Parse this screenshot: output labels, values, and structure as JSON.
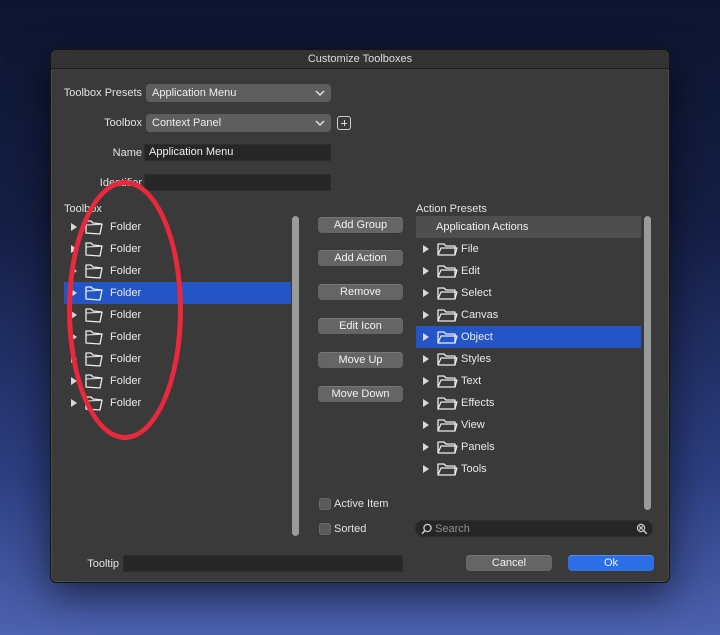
{
  "dialog": {
    "title": "Customize Toolboxes"
  },
  "form": {
    "presets_label": "Toolbox Presets",
    "presets_value": "Application Menu",
    "toolbox_label": "Toolbox",
    "toolbox_value": "Context Panel",
    "name_label": "Name",
    "name_value": "Application Menu",
    "identifier_label": "Identifier",
    "identifier_value": ""
  },
  "toolbox_panel": {
    "title": "Toolbox",
    "selected_index": 3,
    "items": [
      {
        "label": "Folder"
      },
      {
        "label": "Folder"
      },
      {
        "label": "Folder"
      },
      {
        "label": "Folder"
      },
      {
        "label": "Folder"
      },
      {
        "label": "Folder"
      },
      {
        "label": "Folder"
      },
      {
        "label": "Folder"
      },
      {
        "label": "Folder"
      }
    ]
  },
  "actions": {
    "add_group": "Add Group",
    "add_action": "Add Action",
    "remove": "Remove",
    "edit_icon": "Edit Icon",
    "move_up": "Move Up",
    "move_down": "Move Down",
    "active_item": "Active Item",
    "sorted": "Sorted"
  },
  "presets_panel": {
    "title": "Action Presets",
    "header": "Application Actions",
    "selected_index": 4,
    "items": [
      {
        "label": "File"
      },
      {
        "label": "Edit"
      },
      {
        "label": "Select"
      },
      {
        "label": "Canvas"
      },
      {
        "label": "Object"
      },
      {
        "label": "Styles"
      },
      {
        "label": "Text"
      },
      {
        "label": "Effects"
      },
      {
        "label": "View"
      },
      {
        "label": "Panels"
      },
      {
        "label": "Tools"
      }
    ],
    "search_placeholder": "Search"
  },
  "footer": {
    "tooltip_label": "Tooltip",
    "tooltip_value": "",
    "cancel": "Cancel",
    "ok": "Ok"
  },
  "colors": {
    "selection": "#2455c7",
    "primary_button": "#2b6ee6",
    "annotation": "#e8293c"
  }
}
